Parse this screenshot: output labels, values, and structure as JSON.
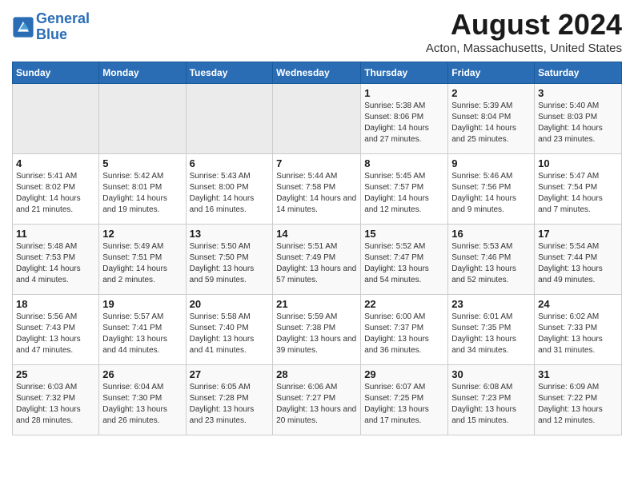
{
  "logo": {
    "text_general": "General",
    "text_blue": "Blue"
  },
  "header": {
    "main_title": "August 2024",
    "sub_title": "Acton, Massachusetts, United States"
  },
  "weekdays": [
    "Sunday",
    "Monday",
    "Tuesday",
    "Wednesday",
    "Thursday",
    "Friday",
    "Saturday"
  ],
  "weeks": [
    [
      {
        "day": "",
        "info": ""
      },
      {
        "day": "",
        "info": ""
      },
      {
        "day": "",
        "info": ""
      },
      {
        "day": "",
        "info": ""
      },
      {
        "day": "1",
        "info": "Sunrise: 5:38 AM\nSunset: 8:06 PM\nDaylight: 14 hours and 27 minutes."
      },
      {
        "day": "2",
        "info": "Sunrise: 5:39 AM\nSunset: 8:04 PM\nDaylight: 14 hours and 25 minutes."
      },
      {
        "day": "3",
        "info": "Sunrise: 5:40 AM\nSunset: 8:03 PM\nDaylight: 14 hours and 23 minutes."
      }
    ],
    [
      {
        "day": "4",
        "info": "Sunrise: 5:41 AM\nSunset: 8:02 PM\nDaylight: 14 hours and 21 minutes."
      },
      {
        "day": "5",
        "info": "Sunrise: 5:42 AM\nSunset: 8:01 PM\nDaylight: 14 hours and 19 minutes."
      },
      {
        "day": "6",
        "info": "Sunrise: 5:43 AM\nSunset: 8:00 PM\nDaylight: 14 hours and 16 minutes."
      },
      {
        "day": "7",
        "info": "Sunrise: 5:44 AM\nSunset: 7:58 PM\nDaylight: 14 hours and 14 minutes."
      },
      {
        "day": "8",
        "info": "Sunrise: 5:45 AM\nSunset: 7:57 PM\nDaylight: 14 hours and 12 minutes."
      },
      {
        "day": "9",
        "info": "Sunrise: 5:46 AM\nSunset: 7:56 PM\nDaylight: 14 hours and 9 minutes."
      },
      {
        "day": "10",
        "info": "Sunrise: 5:47 AM\nSunset: 7:54 PM\nDaylight: 14 hours and 7 minutes."
      }
    ],
    [
      {
        "day": "11",
        "info": "Sunrise: 5:48 AM\nSunset: 7:53 PM\nDaylight: 14 hours and 4 minutes."
      },
      {
        "day": "12",
        "info": "Sunrise: 5:49 AM\nSunset: 7:51 PM\nDaylight: 14 hours and 2 minutes."
      },
      {
        "day": "13",
        "info": "Sunrise: 5:50 AM\nSunset: 7:50 PM\nDaylight: 13 hours and 59 minutes."
      },
      {
        "day": "14",
        "info": "Sunrise: 5:51 AM\nSunset: 7:49 PM\nDaylight: 13 hours and 57 minutes."
      },
      {
        "day": "15",
        "info": "Sunrise: 5:52 AM\nSunset: 7:47 PM\nDaylight: 13 hours and 54 minutes."
      },
      {
        "day": "16",
        "info": "Sunrise: 5:53 AM\nSunset: 7:46 PM\nDaylight: 13 hours and 52 minutes."
      },
      {
        "day": "17",
        "info": "Sunrise: 5:54 AM\nSunset: 7:44 PM\nDaylight: 13 hours and 49 minutes."
      }
    ],
    [
      {
        "day": "18",
        "info": "Sunrise: 5:56 AM\nSunset: 7:43 PM\nDaylight: 13 hours and 47 minutes."
      },
      {
        "day": "19",
        "info": "Sunrise: 5:57 AM\nSunset: 7:41 PM\nDaylight: 13 hours and 44 minutes."
      },
      {
        "day": "20",
        "info": "Sunrise: 5:58 AM\nSunset: 7:40 PM\nDaylight: 13 hours and 41 minutes."
      },
      {
        "day": "21",
        "info": "Sunrise: 5:59 AM\nSunset: 7:38 PM\nDaylight: 13 hours and 39 minutes."
      },
      {
        "day": "22",
        "info": "Sunrise: 6:00 AM\nSunset: 7:37 PM\nDaylight: 13 hours and 36 minutes."
      },
      {
        "day": "23",
        "info": "Sunrise: 6:01 AM\nSunset: 7:35 PM\nDaylight: 13 hours and 34 minutes."
      },
      {
        "day": "24",
        "info": "Sunrise: 6:02 AM\nSunset: 7:33 PM\nDaylight: 13 hours and 31 minutes."
      }
    ],
    [
      {
        "day": "25",
        "info": "Sunrise: 6:03 AM\nSunset: 7:32 PM\nDaylight: 13 hours and 28 minutes."
      },
      {
        "day": "26",
        "info": "Sunrise: 6:04 AM\nSunset: 7:30 PM\nDaylight: 13 hours and 26 minutes."
      },
      {
        "day": "27",
        "info": "Sunrise: 6:05 AM\nSunset: 7:28 PM\nDaylight: 13 hours and 23 minutes."
      },
      {
        "day": "28",
        "info": "Sunrise: 6:06 AM\nSunset: 7:27 PM\nDaylight: 13 hours and 20 minutes."
      },
      {
        "day": "29",
        "info": "Sunrise: 6:07 AM\nSunset: 7:25 PM\nDaylight: 13 hours and 17 minutes."
      },
      {
        "day": "30",
        "info": "Sunrise: 6:08 AM\nSunset: 7:23 PM\nDaylight: 13 hours and 15 minutes."
      },
      {
        "day": "31",
        "info": "Sunrise: 6:09 AM\nSunset: 7:22 PM\nDaylight: 13 hours and 12 minutes."
      }
    ]
  ]
}
